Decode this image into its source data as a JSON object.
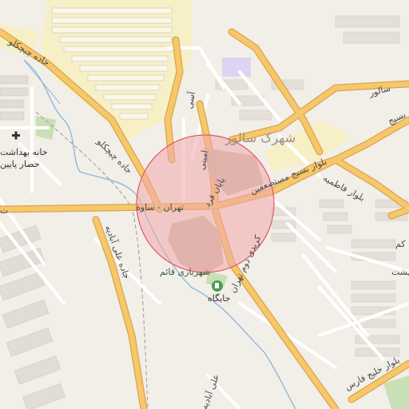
{
  "colors": {
    "background": "#f2efe9",
    "building": "#dfdad3",
    "building_stroke": "#cfc8bf",
    "residential_yellow": "#f7f0c7",
    "road_major": "#f7c76b",
    "road_major_casing": "#d9a54a",
    "road_minor": "#ffffff",
    "road_minor_casing": "#d8d2ca",
    "water": "#8fb8d8",
    "park": "#c9dfb5",
    "interchange_fill": "#c8bda7",
    "circle_fill": "#f3a7ab",
    "circle_stroke": "#e05a64",
    "railway": "#9a9a9a",
    "purple_area": "#ddd3f2"
  },
  "labels": {
    "salvor_town": "شهرک سالور",
    "salvor_street": "سالور",
    "basij_mostazafin_blvd": "بلوار بسیج مستضعفین",
    "tehran_saveh": "تهران - ساوه",
    "tehran_saveh_left": "ت",
    "blvd_fatemiyeh": "بلوار فاطمیه",
    "karimi_mashhur": "کریدی دوم تهران",
    "jadde_chichaklu": "جاده چیچکلو",
    "jadde_chichaklu_2": "جاده چیچکلو",
    "jadde_ali_abadiyeh": "جاده علی آبادیه",
    "khane_behdasht": "خانه بهداشت",
    "hesar_paein": "حصار پایین",
    "shahrbazi_ghaem": "شهربازی قائم",
    "jaygah": "جایگاه",
    "emami": "امینی",
    "asi": "آسی",
    "mid_interchange": "پایان فرد",
    "behesht": "بهشت",
    "blvd_khalij_fars": "بلوار خلیج فارس",
    "basij_short": "بسیج",
    "ali_abad_bottom": "علی آبادیه",
    "road_bottom_mid": "کم"
  },
  "icons": {
    "health_center": "health-cross-icon",
    "fuel_station": "fuel-pump-icon"
  },
  "overlay": {
    "type": "circle-marker"
  }
}
